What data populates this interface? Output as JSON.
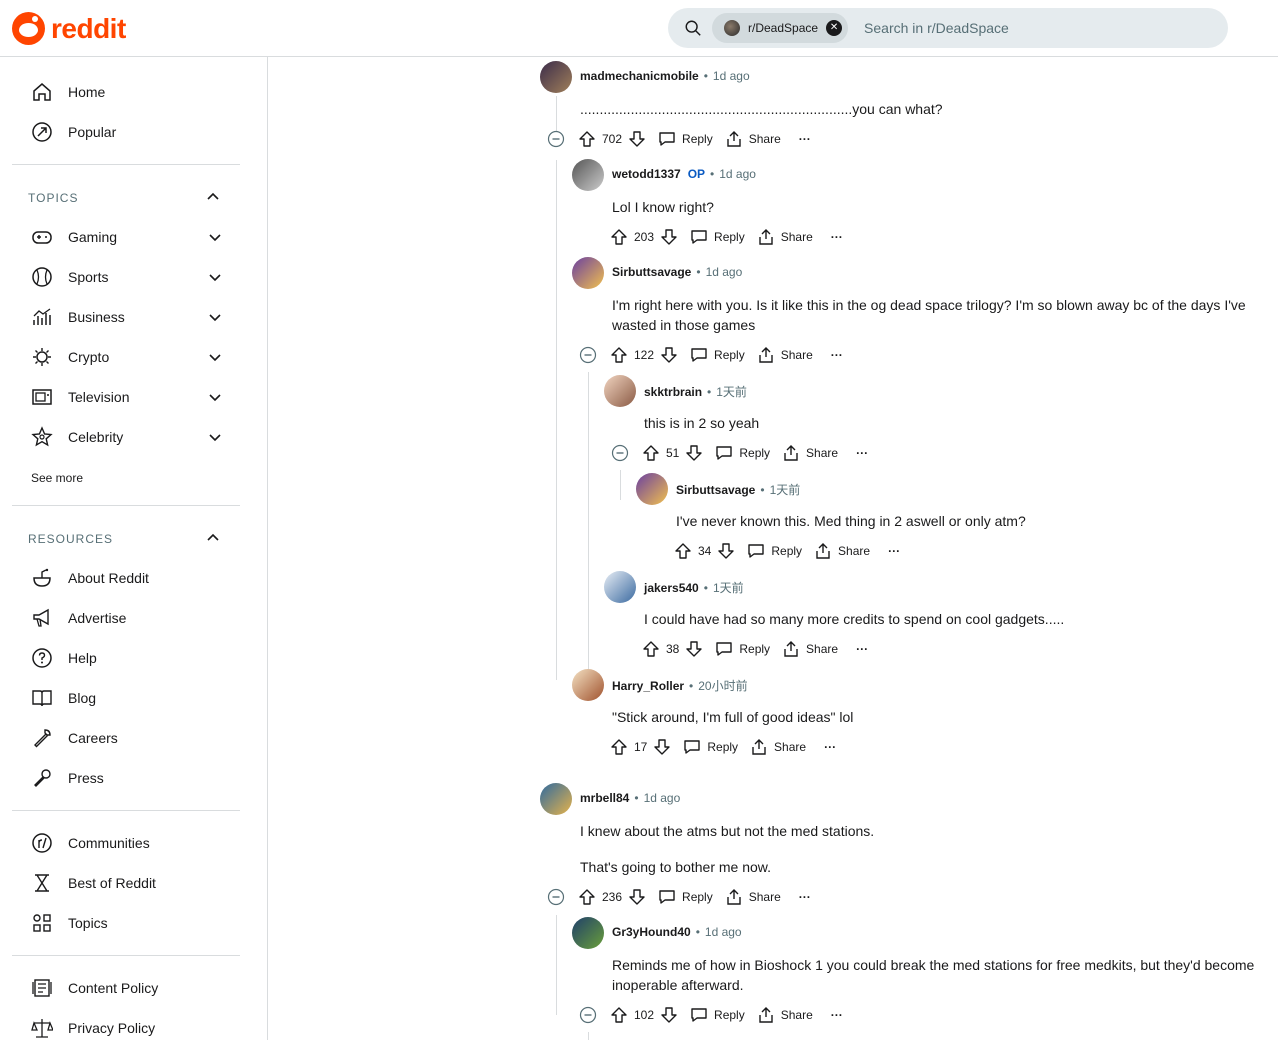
{
  "brand": {
    "name": "reddit",
    "color": "#ff4500"
  },
  "search": {
    "chip_label": "r/DeadSpace",
    "placeholder": "Search in r/DeadSpace"
  },
  "sidebar": {
    "main": [
      {
        "label": "Home",
        "icon": "home-icon"
      },
      {
        "label": "Popular",
        "icon": "popular-icon"
      }
    ],
    "topics_title": "TOPICS",
    "topics": [
      {
        "label": "Gaming",
        "icon": "gamepad-icon"
      },
      {
        "label": "Sports",
        "icon": "sports-icon"
      },
      {
        "label": "Business",
        "icon": "chart-icon"
      },
      {
        "label": "Crypto",
        "icon": "crypto-icon"
      },
      {
        "label": "Television",
        "icon": "television-icon"
      },
      {
        "label": "Celebrity",
        "icon": "star-icon"
      }
    ],
    "see_more": "See more",
    "resources_title": "RESOURCES",
    "resources": [
      {
        "label": "About Reddit",
        "icon": "reddit-bowl-icon"
      },
      {
        "label": "Advertise",
        "icon": "megaphone-icon"
      },
      {
        "label": "Help",
        "icon": "help-icon"
      },
      {
        "label": "Blog",
        "icon": "book-icon"
      },
      {
        "label": "Careers",
        "icon": "wrench-icon"
      },
      {
        "label": "Press",
        "icon": "mic-icon"
      }
    ],
    "community": [
      {
        "label": "Communities",
        "icon": "communities-icon"
      },
      {
        "label": "Best of Reddit",
        "icon": "hourglass-icon"
      },
      {
        "label": "Topics",
        "icon": "topics-grid-icon"
      }
    ],
    "policies": [
      {
        "label": "Content Policy",
        "icon": "content-policy-icon"
      },
      {
        "label": "Privacy Policy",
        "icon": "privacy-policy-icon"
      }
    ]
  },
  "actions": {
    "reply": "Reply",
    "share": "Share",
    "more": "···"
  },
  "comments": [
    {
      "author": "madmechanicmobile",
      "op": "",
      "time": "1d ago",
      "body": [
        "......................................................................you can what?"
      ],
      "votes": "702"
    },
    {
      "author": "wetodd1337",
      "op": "OP",
      "time": "1d ago",
      "body": [
        "Lol I know right?"
      ],
      "votes": "203"
    },
    {
      "author": "Sirbuttsavage",
      "op": "",
      "time": "1d ago",
      "body": [
        "I'm right here with you. Is it like this in the og dead space trilogy? I'm so blown away bc of the days I've",
        "wasted in those games"
      ],
      "votes": "122"
    },
    {
      "author": "skktrbrain",
      "op": "",
      "time": "1天前",
      "body": [
        "this is in 2 so yeah"
      ],
      "votes": "51"
    },
    {
      "author": "Sirbuttsavage",
      "op": "",
      "time": "1天前",
      "body": [
        "I've never known this. Med thing in 2 aswell or only atm?"
      ],
      "votes": "34"
    },
    {
      "author": "jakers540",
      "op": "",
      "time": "1天前",
      "body": [
        "I could have had so many more credits to spend on cool gadgets....."
      ],
      "votes": "38"
    },
    {
      "author": "Harry_Roller",
      "op": "",
      "time": "20小时前",
      "body": [
        "\"Stick around, I'm full of good ideas\" lol"
      ],
      "votes": "17"
    },
    {
      "author": "mrbell84",
      "op": "",
      "time": "1d ago",
      "body": [
        "I knew about the atms but not the med stations.",
        "That's going to bother me now."
      ],
      "votes": "236"
    },
    {
      "author": "Gr3yHound40",
      "op": "",
      "time": "1d ago",
      "body": [
        "Reminds me of how in Bioshock 1 you could break the med stations for free medkits, but they'd become",
        "inoperable afterward."
      ],
      "votes": "102"
    }
  ]
}
